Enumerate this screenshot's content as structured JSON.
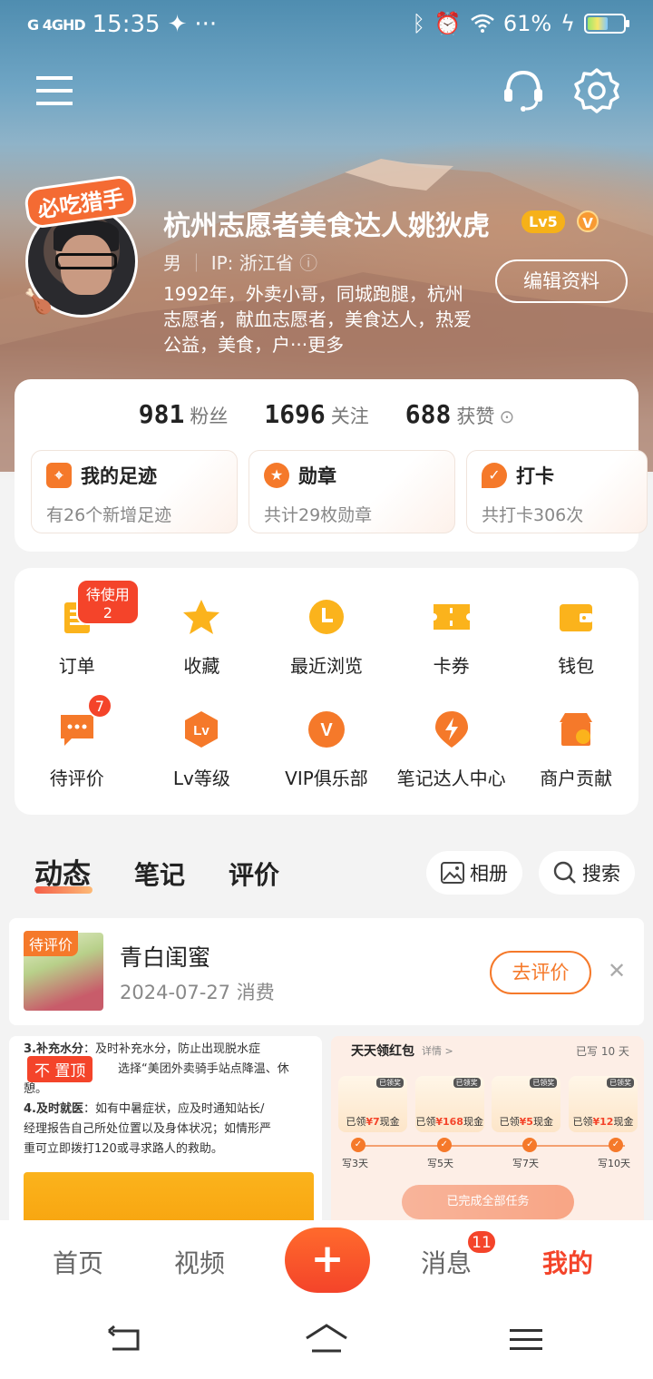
{
  "status_bar": {
    "signal": "G 4GHD",
    "time": "15:35",
    "extra": "···",
    "battery_pct": "61%",
    "battery_level": 0.61
  },
  "profile": {
    "sticker": "必吃猎手",
    "name": "杭州志愿者美食达人姚狄虎",
    "level": "Lv5",
    "vip": "V",
    "gender": "男",
    "ip": "IP: 浙江省",
    "bio": "1992年，外卖小哥，同城跑腿，杭州志愿者，献血志愿者，美食达人，热爱公益，美食，户···更多",
    "edit_label": "编辑资料"
  },
  "stats": [
    {
      "num": "981",
      "label": "粉丝"
    },
    {
      "num": "1696",
      "label": "关注"
    },
    {
      "num": "688",
      "label": "获赞"
    }
  ],
  "mini_cards": [
    {
      "title": "我的足迹",
      "sub": "有26个新增足迹",
      "icon": "map-icon"
    },
    {
      "title": "勋章",
      "sub": "共计29枚勋章",
      "icon": "medal-icon"
    },
    {
      "title": "打卡",
      "sub": "共打卡306次",
      "icon": "checkin-icon"
    }
  ],
  "menu": [
    {
      "label": "订单",
      "icon": "order-icon",
      "tip": "待使用2"
    },
    {
      "label": "收藏",
      "icon": "star-icon"
    },
    {
      "label": "最近浏览",
      "icon": "clock-icon"
    },
    {
      "label": "卡券",
      "icon": "ticket-icon"
    },
    {
      "label": "钱包",
      "icon": "wallet-icon"
    },
    {
      "label": "待评价",
      "icon": "comment-icon",
      "count": "7"
    },
    {
      "label": "Lv等级",
      "icon": "level-icon"
    },
    {
      "label": "VIP俱乐部",
      "icon": "vip-icon"
    },
    {
      "label": "笔记达人中心",
      "icon": "bolt-icon"
    },
    {
      "label": "商户贡献",
      "icon": "shop-icon"
    }
  ],
  "tabs": [
    "动态",
    "笔记",
    "评价"
  ],
  "album_label": "相册",
  "search_label": "搜索",
  "pending": {
    "tag": "待评价",
    "title": "青白闺蜜",
    "sub": "2024-07-27 消费",
    "action": "去评价"
  },
  "feed_left": {
    "pin": "不 置顶",
    "line1_bold": "3.补充水分",
    "line1": "：及时补充水分，防止出现脱水症",
    "line2": "选择“美团外卖骑手站点降温、休",
    "line3": "憩。",
    "line4_bold": "4.及时就医",
    "line4": "：如有中暑症状，应及时通知站长/",
    "line5": "经理报告自己所处位置以及身体状况；如情形严",
    "line6": "重可立即拨打120或寻求路人的救助。"
  },
  "feed_right": {
    "title": "天天领红包",
    "detail": "详情 >",
    "written": "已写 10 天",
    "coins": [
      {
        "tag": "已领奖",
        "pre": "已领",
        "amt": "¥7",
        "post": "现金"
      },
      {
        "tag": "已领奖",
        "pre": "已领",
        "amt": "¥168",
        "post": "现金"
      },
      {
        "tag": "已领奖",
        "pre": "已领",
        "amt": "¥5",
        "post": "现金"
      },
      {
        "tag": "已领奖",
        "pre": "已领",
        "amt": "¥12",
        "post": "现金"
      }
    ],
    "days": [
      "写3天",
      "写5天",
      "写7天",
      "写10天"
    ],
    "done": "已完成全部任务"
  },
  "bottom_nav": [
    {
      "label": "首页"
    },
    {
      "label": "视频"
    },
    {
      "label": "消息",
      "badge": "11"
    },
    {
      "label": "我的"
    }
  ],
  "plus": "+"
}
